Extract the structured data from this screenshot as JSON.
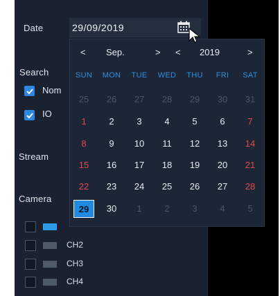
{
  "labels": {
    "date": "Date",
    "search_type": "Search",
    "stream_type": "Stream",
    "camera": "Camera"
  },
  "date_field": {
    "value": "29/09/2019",
    "icon": "calendar-icon"
  },
  "checkboxes": [
    {
      "label": "Nom",
      "checked": true
    },
    {
      "label": "IO",
      "checked": true
    }
  ],
  "channels": [
    {
      "label": "",
      "checked": false,
      "active": true
    },
    {
      "label": "CH2",
      "checked": false,
      "active": false
    },
    {
      "label": "CH3",
      "checked": false,
      "active": false
    },
    {
      "label": "CH4",
      "checked": false,
      "active": false
    }
  ],
  "calendar": {
    "prev_month": "<",
    "month": "Sep.",
    "next_month": ">",
    "prev_year": "<",
    "year": "2019",
    "next_year": ">",
    "weekdays": [
      "SUN",
      "MON",
      "TUE",
      "WED",
      "THU",
      "FRI",
      "SAT"
    ],
    "weeks": [
      [
        {
          "t": "25",
          "s": "dim"
        },
        {
          "t": "26",
          "s": "dim"
        },
        {
          "t": "27",
          "s": "dim"
        },
        {
          "t": "28",
          "s": "dim"
        },
        {
          "t": "29",
          "s": "dim"
        },
        {
          "t": "30",
          "s": "dim"
        },
        {
          "t": "31",
          "s": "dim"
        }
      ],
      [
        {
          "t": "1",
          "s": "red"
        },
        {
          "t": "2",
          "s": "cur"
        },
        {
          "t": "3",
          "s": "cur"
        },
        {
          "t": "4",
          "s": "cur"
        },
        {
          "t": "5",
          "s": "cur"
        },
        {
          "t": "6",
          "s": "cur"
        },
        {
          "t": "7",
          "s": "red"
        }
      ],
      [
        {
          "t": "8",
          "s": "red"
        },
        {
          "t": "9",
          "s": "cur"
        },
        {
          "t": "10",
          "s": "cur"
        },
        {
          "t": "11",
          "s": "cur"
        },
        {
          "t": "12",
          "s": "cur"
        },
        {
          "t": "13",
          "s": "cur"
        },
        {
          "t": "14",
          "s": "red"
        }
      ],
      [
        {
          "t": "15",
          "s": "red"
        },
        {
          "t": "16",
          "s": "cur"
        },
        {
          "t": "17",
          "s": "cur"
        },
        {
          "t": "18",
          "s": "cur"
        },
        {
          "t": "19",
          "s": "cur"
        },
        {
          "t": "20",
          "s": "cur"
        },
        {
          "t": "21",
          "s": "red"
        }
      ],
      [
        {
          "t": "22",
          "s": "red"
        },
        {
          "t": "23",
          "s": "cur"
        },
        {
          "t": "24",
          "s": "cur"
        },
        {
          "t": "25",
          "s": "cur"
        },
        {
          "t": "26",
          "s": "cur"
        },
        {
          "t": "27",
          "s": "cur"
        },
        {
          "t": "28",
          "s": "red"
        }
      ],
      [
        {
          "t": "29",
          "s": "sel"
        },
        {
          "t": "30",
          "s": "cur"
        },
        {
          "t": "1",
          "s": "dim"
        },
        {
          "t": "2",
          "s": "dim"
        },
        {
          "t": "3",
          "s": "dim"
        },
        {
          "t": "4",
          "s": "dim"
        },
        {
          "t": "5",
          "s": "dim"
        }
      ]
    ],
    "selected": "29"
  },
  "colors": {
    "accent": "#1f8ae0",
    "weekend": "#e0494b",
    "panel": "#1a2231"
  }
}
